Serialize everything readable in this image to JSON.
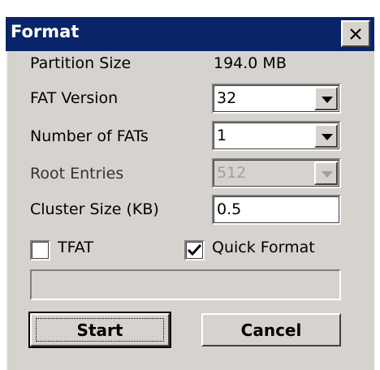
{
  "window": {
    "title": "Format",
    "close_icon": "close-icon"
  },
  "fields": {
    "partition_size": {
      "label": "Partition Size",
      "value": "194.0 MB"
    },
    "fat_version": {
      "label": "FAT Version",
      "value": "32"
    },
    "number_of_fats": {
      "label": "Number of FATs",
      "value": "1"
    },
    "root_entries": {
      "label": "Root Entries",
      "value": "512",
      "disabled": true
    },
    "cluster_size": {
      "label": "Cluster Size (KB)",
      "value": "0.5"
    }
  },
  "options": {
    "tfat": {
      "label": "TFAT",
      "checked": false
    },
    "quick_format": {
      "label": "Quick Format",
      "checked": true
    }
  },
  "progress": {
    "fraction": 0.0
  },
  "buttons": {
    "start": "Start",
    "cancel": "Cancel"
  },
  "colors": {
    "titlebar": "#0a246a",
    "dialog_bg": "#d6d3ce"
  }
}
